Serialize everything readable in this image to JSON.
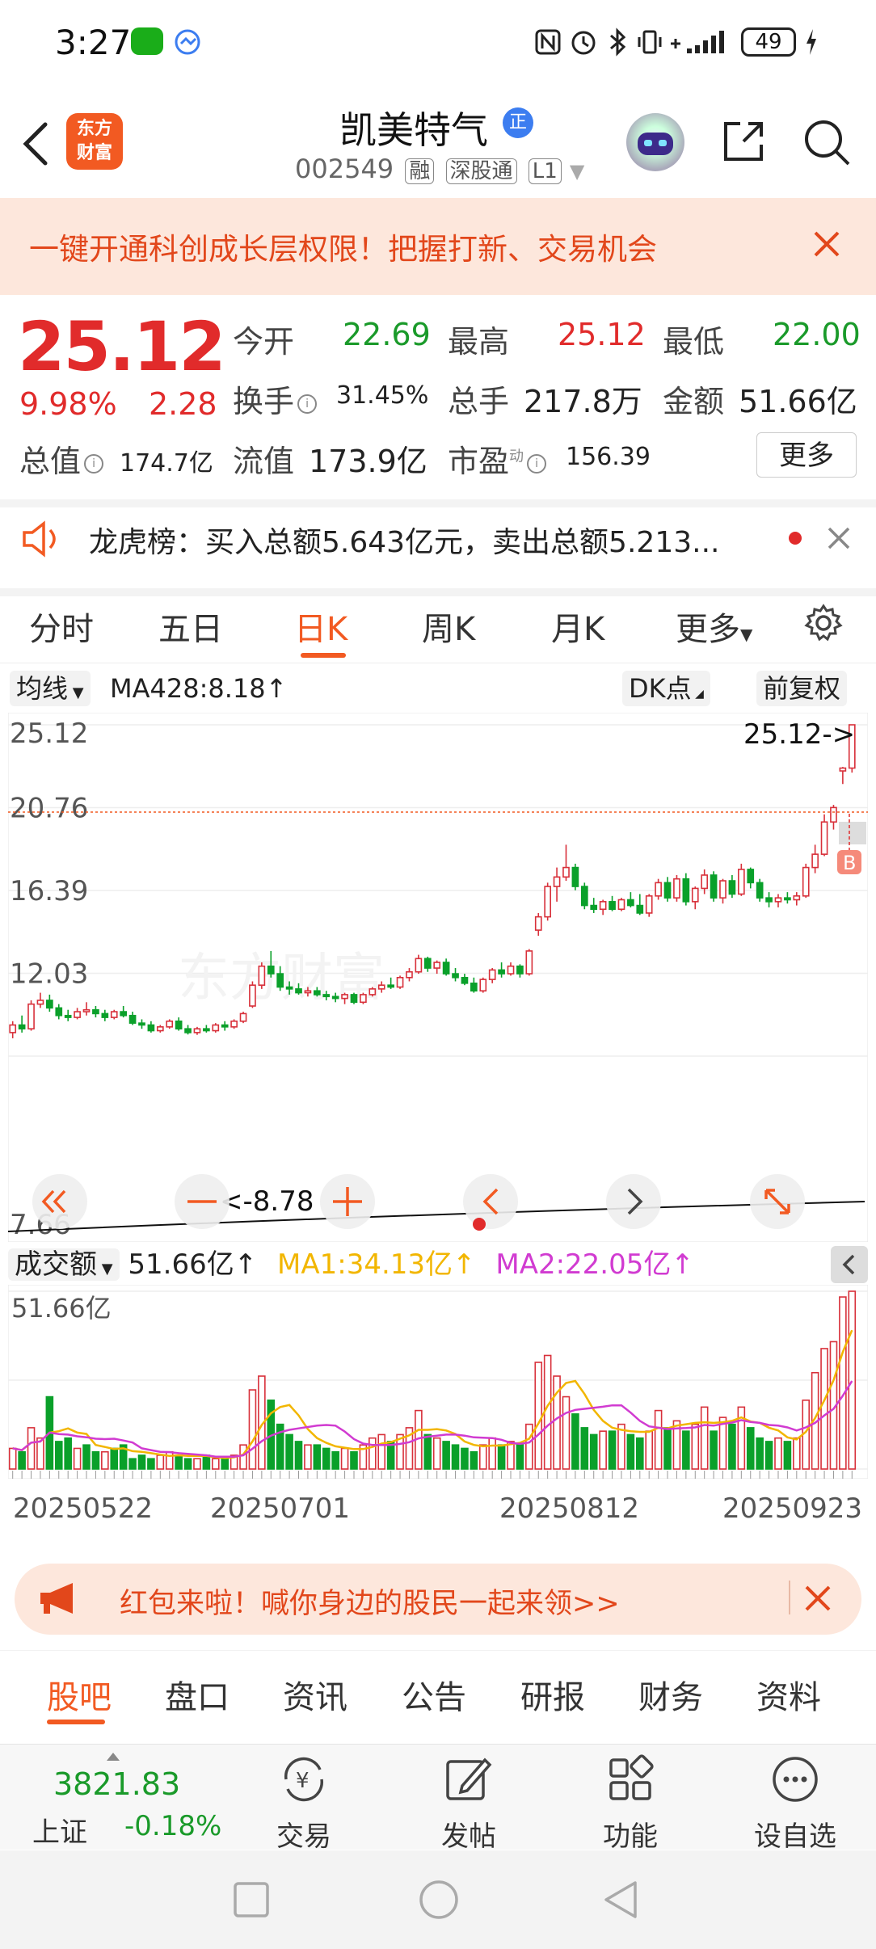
{
  "status_bar": {
    "time": "3:27",
    "battery": "49"
  },
  "header": {
    "logo_text_line1": "东方",
    "logo_text_line2": "财富",
    "stock_name": "凯美特气",
    "badge": "正",
    "code": "002549",
    "tags": [
      "融",
      "深股通",
      "L1"
    ]
  },
  "banner": {
    "text": "一键开通科创成长层权限！把握打新、交易机会"
  },
  "quote": {
    "price": "25.12",
    "pct": "9.98%",
    "change": "2.28",
    "open_label": "今开",
    "open": "22.69",
    "high_label": "最高",
    "high": "25.12",
    "low_label": "最低",
    "low": "22.00",
    "turnover_label": "换手",
    "turnover": "31.45%",
    "volume_label": "总手",
    "volume": "217.8万",
    "amount_label": "金额",
    "amount": "51.66亿",
    "mktcap_label": "总值",
    "mktcap": "174.7亿",
    "float_label": "流值",
    "float": "173.9亿",
    "pe_label": "市盈",
    "pe_sup": "动",
    "pe": "156.39",
    "more": "更多"
  },
  "lhb": {
    "text": "龙虎榜：买入总额5.643亿元，卖出总额5.213..."
  },
  "period_tabs": [
    "分时",
    "五日",
    "日K",
    "周K",
    "月K",
    "更多"
  ],
  "chart_header": {
    "ma_select": "均线",
    "ma_value": "MA428:8.18↑",
    "dk": "DK点",
    "adjust": "前复权"
  },
  "chart_data": [
    {
      "type": "candlestick",
      "y_ticks": [
        "25.12",
        "20.76",
        "16.39",
        "12.03",
        "7.66"
      ],
      "ylim": [
        7.66,
        25.12
      ],
      "annotations": {
        "high_label": "25.12->",
        "low_label": "<-8.78",
        "buy_marker": "B"
      },
      "watermark": "东方财富",
      "ohlc": [
        [
          8.9,
          9.5,
          8.6,
          9.3
        ],
        [
          9.3,
          9.8,
          8.9,
          9.1
        ],
        [
          9.1,
          10.6,
          9.0,
          10.4
        ],
        [
          10.4,
          11.0,
          10.2,
          10.6
        ],
        [
          10.6,
          10.9,
          10.0,
          10.2
        ],
        [
          10.2,
          10.4,
          9.6,
          9.8
        ],
        [
          9.8,
          10.1,
          9.5,
          9.7
        ],
        [
          9.7,
          10.2,
          9.6,
          10.0
        ],
        [
          10.0,
          10.5,
          9.8,
          10.1
        ],
        [
          10.1,
          10.3,
          9.7,
          9.9
        ],
        [
          9.9,
          10.1,
          9.5,
          9.7
        ],
        [
          9.7,
          10.1,
          9.6,
          10.0
        ],
        [
          10.0,
          10.3,
          9.7,
          9.8
        ],
        [
          9.8,
          10.0,
          9.3,
          9.4
        ],
        [
          9.4,
          9.6,
          9.1,
          9.3
        ],
        [
          9.3,
          9.5,
          8.9,
          9.0
        ],
        [
          9.0,
          9.3,
          8.9,
          9.2
        ],
        [
          9.2,
          9.6,
          9.1,
          9.5
        ],
        [
          9.5,
          9.7,
          9.0,
          9.1
        ],
        [
          9.1,
          9.3,
          8.8,
          8.9
        ],
        [
          8.9,
          9.2,
          8.78,
          9.1
        ],
        [
          9.1,
          9.3,
          8.9,
          9.0
        ],
        [
          9.0,
          9.4,
          8.9,
          9.3
        ],
        [
          9.3,
          9.5,
          9.0,
          9.2
        ],
        [
          9.2,
          9.6,
          9.1,
          9.5
        ],
        [
          9.5,
          10.0,
          9.4,
          9.9
        ],
        [
          10.3,
          11.6,
          10.2,
          11.4
        ],
        [
          11.4,
          12.6,
          11.2,
          12.4
        ],
        [
          12.4,
          13.2,
          11.8,
          12.0
        ],
        [
          12.0,
          12.4,
          11.1,
          11.3
        ],
        [
          11.3,
          11.6,
          10.9,
          11.2
        ],
        [
          11.2,
          11.5,
          10.9,
          11.0
        ],
        [
          11.0,
          11.3,
          10.8,
          11.1
        ],
        [
          11.1,
          11.3,
          10.8,
          10.9
        ],
        [
          10.9,
          11.1,
          10.6,
          10.8
        ],
        [
          10.8,
          11.0,
          10.5,
          10.7
        ],
        [
          10.7,
          11.0,
          10.4,
          10.9
        ],
        [
          10.9,
          11.0,
          10.4,
          10.5
        ],
        [
          10.5,
          11.0,
          10.4,
          10.9
        ],
        [
          10.9,
          11.3,
          10.8,
          11.2
        ],
        [
          11.2,
          11.6,
          11.0,
          11.4
        ],
        [
          11.4,
          11.8,
          11.2,
          11.3
        ],
        [
          11.3,
          11.9,
          11.2,
          11.8
        ],
        [
          11.8,
          12.3,
          11.6,
          12.1
        ],
        [
          12.1,
          13.0,
          12.0,
          12.8
        ],
        [
          12.8,
          12.9,
          12.1,
          12.3
        ],
        [
          12.3,
          12.7,
          12.0,
          12.6
        ],
        [
          12.6,
          12.8,
          11.9,
          12.0
        ],
        [
          12.0,
          12.3,
          11.6,
          11.8
        ],
        [
          11.8,
          12.0,
          11.4,
          11.5
        ],
        [
          11.5,
          11.8,
          11.0,
          11.1
        ],
        [
          11.1,
          11.8,
          11.0,
          11.7
        ],
        [
          11.7,
          12.3,
          11.5,
          12.2
        ],
        [
          12.2,
          12.6,
          11.8,
          12.0
        ],
        [
          12.0,
          12.6,
          11.9,
          12.4
        ],
        [
          12.4,
          12.5,
          11.8,
          12.0
        ],
        [
          12.0,
          13.3,
          11.9,
          13.2
        ],
        [
          14.3,
          15.2,
          14.0,
          15.0
        ],
        [
          15.0,
          16.8,
          14.8,
          16.6
        ],
        [
          16.6,
          17.6,
          15.8,
          17.1
        ],
        [
          17.1,
          18.8,
          16.9,
          17.6
        ],
        [
          17.6,
          17.8,
          16.4,
          16.6
        ],
        [
          16.6,
          16.8,
          15.4,
          15.6
        ],
        [
          15.6,
          16.0,
          15.2,
          15.4
        ],
        [
          15.4,
          15.9,
          15.1,
          15.8
        ],
        [
          15.8,
          16.1,
          15.3,
          15.4
        ],
        [
          15.4,
          16.0,
          15.3,
          15.9
        ],
        [
          15.9,
          16.3,
          15.5,
          15.6
        ],
        [
          15.6,
          16.2,
          15.1,
          15.2
        ],
        [
          15.2,
          16.2,
          15.0,
          16.1
        ],
        [
          16.1,
          17.0,
          15.9,
          16.8
        ],
        [
          16.8,
          17.1,
          15.8,
          16.0
        ],
        [
          16.0,
          17.2,
          15.8,
          17.0
        ],
        [
          17.0,
          17.3,
          15.6,
          15.8
        ],
        [
          15.8,
          16.6,
          15.4,
          16.5
        ],
        [
          16.5,
          17.5,
          16.2,
          17.2
        ],
        [
          17.2,
          17.4,
          15.8,
          16.0
        ],
        [
          16.0,
          17.0,
          15.7,
          16.9
        ],
        [
          16.9,
          17.2,
          16.0,
          16.2
        ],
        [
          16.2,
          17.8,
          16.1,
          17.5
        ],
        [
          17.5,
          17.6,
          16.5,
          16.8
        ],
        [
          16.8,
          17.0,
          15.8,
          16.0
        ],
        [
          16.0,
          16.3,
          15.5,
          15.8
        ],
        [
          15.8,
          16.2,
          15.5,
          16.0
        ],
        [
          16.0,
          16.3,
          15.7,
          15.9
        ],
        [
          15.9,
          16.3,
          15.6,
          16.1
        ],
        [
          16.1,
          17.8,
          16.0,
          17.6
        ],
        [
          17.6,
          18.8,
          17.3,
          18.3
        ],
        [
          18.3,
          20.4,
          18.2,
          20.0
        ],
        [
          20.0,
          20.9,
          19.6,
          20.76
        ],
        [
          22.69,
          22.9,
          22.0,
          22.84
        ],
        [
          22.84,
          25.12,
          22.6,
          25.12
        ]
      ]
    },
    {
      "type": "bar",
      "title": "成交额",
      "value_label": "51.66亿↑",
      "ma1_label": "MA1:34.13亿↑",
      "ma2_label": "MA2:22.05亿↑",
      "y_top": "51.66亿",
      "x_ticks": [
        "20250522",
        "20250701",
        "20250812",
        "20250923"
      ],
      "values": [
        6,
        5,
        12,
        9,
        21,
        8,
        9,
        6,
        7,
        5,
        5,
        6,
        7,
        3,
        4,
        3,
        4,
        5,
        4,
        3,
        3,
        4,
        3,
        3,
        4,
        7,
        23,
        27,
        20,
        13,
        10,
        8,
        7,
        7,
        6,
        5,
        6,
        5,
        7,
        9,
        10,
        8,
        10,
        12,
        17,
        10,
        9,
        8,
        7,
        6,
        5,
        7,
        9,
        7,
        8,
        7,
        13,
        31,
        33,
        27,
        21,
        16,
        12,
        10,
        11,
        11,
        13,
        10,
        9,
        11,
        17,
        12,
        14,
        11,
        13,
        18,
        11,
        15,
        13,
        18,
        12,
        9,
        8,
        9,
        8,
        9,
        20,
        28,
        35,
        37,
        50,
        51.66
      ],
      "up": [
        1,
        0,
        1,
        1,
        0,
        0,
        0,
        1,
        0,
        0,
        1,
        0,
        0,
        0,
        0,
        0,
        1,
        1,
        0,
        0,
        1,
        0,
        1,
        0,
        1,
        1,
        1,
        1,
        0,
        0,
        0,
        0,
        1,
        0,
        0,
        0,
        1,
        0,
        1,
        1,
        1,
        0,
        1,
        1,
        1,
        0,
        1,
        0,
        0,
        0,
        0,
        1,
        1,
        0,
        1,
        0,
        1,
        1,
        1,
        1,
        1,
        0,
        0,
        0,
        1,
        0,
        1,
        0,
        0,
        1,
        1,
        0,
        1,
        0,
        1,
        1,
        0,
        1,
        0,
        1,
        0,
        0,
        0,
        1,
        0,
        1,
        1,
        1,
        1,
        1,
        1,
        1
      ]
    }
  ],
  "ad": {
    "text": "红包来啦！喊你身边的股民一起来领>>"
  },
  "tabs2": [
    "股吧",
    "盘口",
    "资讯",
    "公告",
    "研报",
    "财务",
    "资料"
  ],
  "bottom": {
    "index_value": "3821.83",
    "index_name": "上证",
    "index_pct": "-0.18%",
    "items": [
      "交易",
      "发帖",
      "功能",
      "设自选"
    ]
  }
}
